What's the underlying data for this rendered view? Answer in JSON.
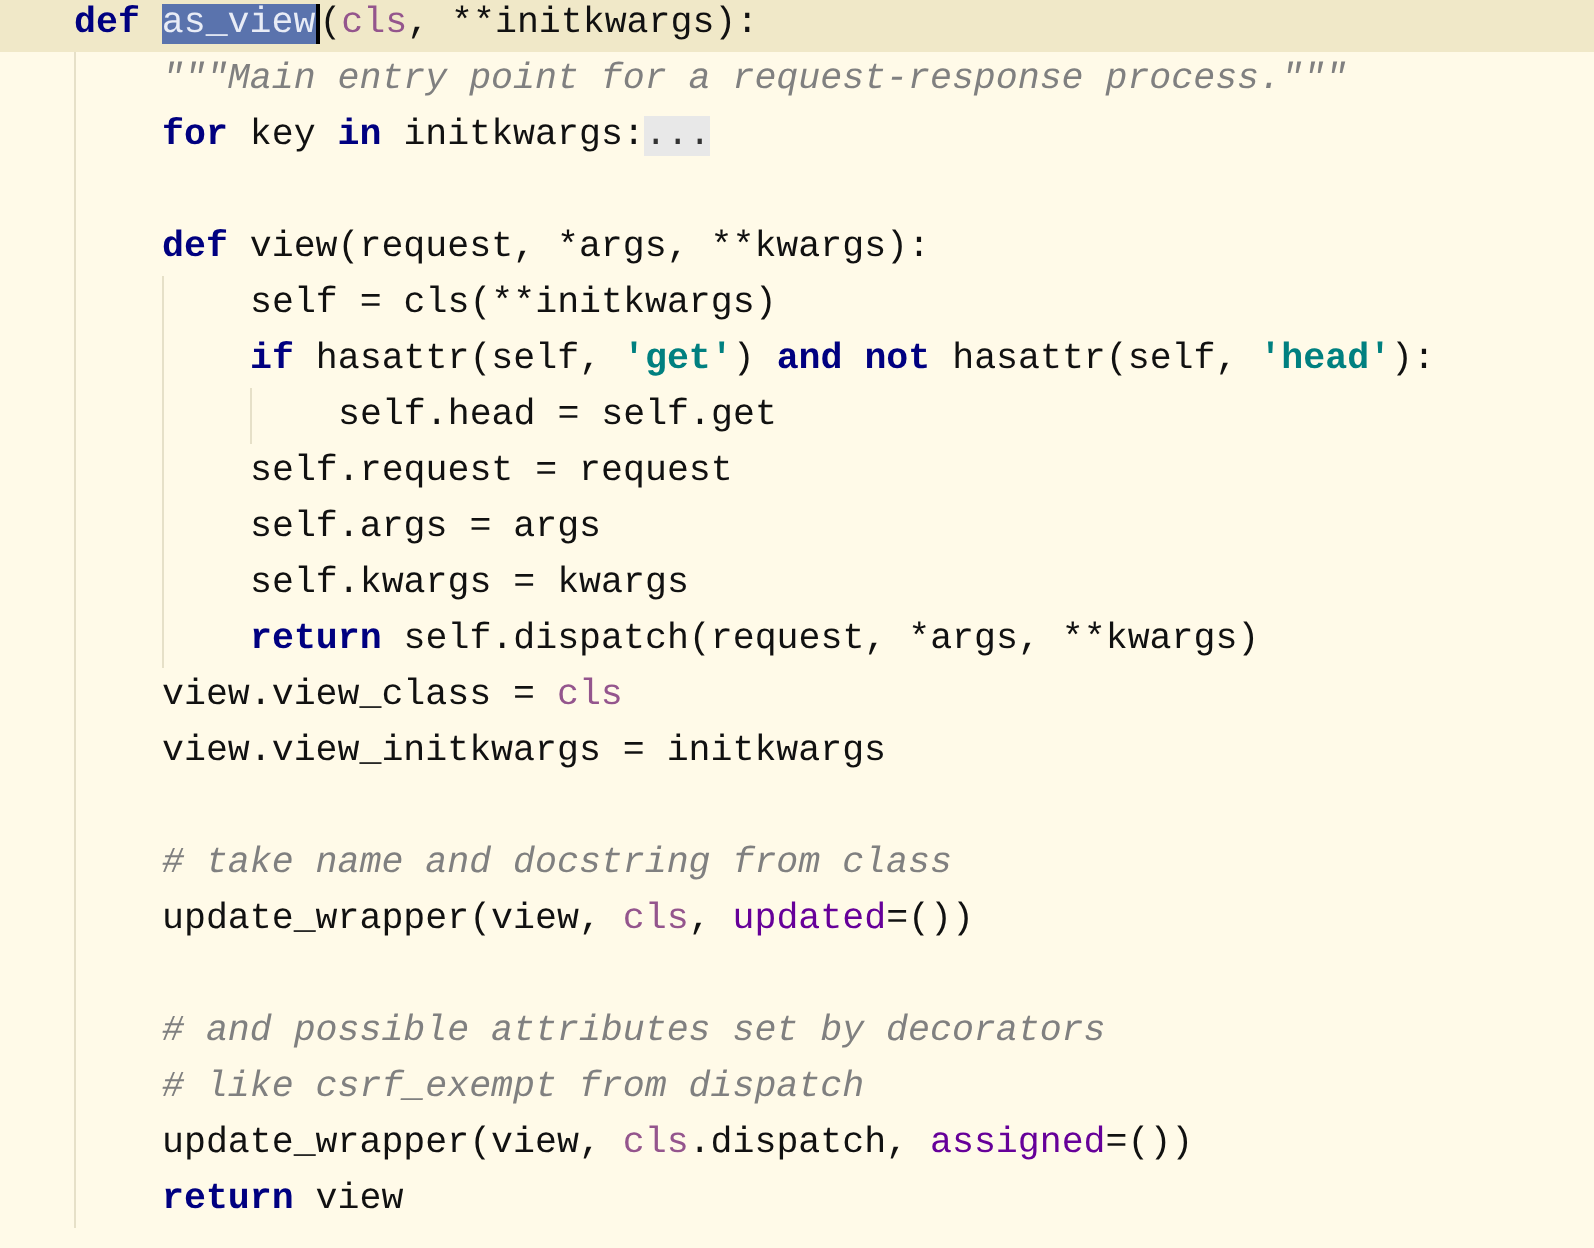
{
  "editor": {
    "lines": [
      {
        "kind": "code",
        "current": true,
        "tokens": [
          {
            "kind": "kw",
            "text": "def "
          },
          {
            "kind": "plain",
            "text": "as_view",
            "selected": true
          },
          {
            "kind": "plain",
            "text": "("
          },
          {
            "kind": "param",
            "text": "cls"
          },
          {
            "kind": "plain",
            "text": ", **initkwargs):"
          }
        ],
        "children": [
          {
            "kind": "code",
            "tokens": [
              {
                "kind": "doc",
                "text": "\"\"\"Main entry point for a request-response process.\"\"\""
              }
            ]
          },
          {
            "kind": "code",
            "tokens": [
              {
                "kind": "kw",
                "text": "for"
              },
              {
                "kind": "plain",
                "text": " key "
              },
              {
                "kind": "kw",
                "text": "in"
              },
              {
                "kind": "plain",
                "text": " initkwargs:"
              },
              {
                "kind": "fold",
                "text": "..."
              }
            ]
          },
          {
            "kind": "blank"
          },
          {
            "kind": "code",
            "tokens": [
              {
                "kind": "kw",
                "text": "def "
              },
              {
                "kind": "plain",
                "text": "view(request, *args, **kwargs):"
              }
            ],
            "children": [
              {
                "kind": "code",
                "tokens": [
                  {
                    "kind": "plain",
                    "text": "self = cls(**initkwargs)"
                  }
                ]
              },
              {
                "kind": "code",
                "tokens": [
                  {
                    "kind": "kw",
                    "text": "if "
                  },
                  {
                    "kind": "plain",
                    "text": "hasattr(self, "
                  },
                  {
                    "kind": "str",
                    "text": "'get'"
                  },
                  {
                    "kind": "plain",
                    "text": ") "
                  },
                  {
                    "kind": "kw",
                    "text": "and not "
                  },
                  {
                    "kind": "plain",
                    "text": "hasattr(self, "
                  },
                  {
                    "kind": "str",
                    "text": "'head'"
                  },
                  {
                    "kind": "plain",
                    "text": "):"
                  }
                ],
                "children": [
                  {
                    "kind": "code",
                    "tokens": [
                      {
                        "kind": "plain",
                        "text": "self.head = self.get"
                      }
                    ]
                  }
                ]
              },
              {
                "kind": "code",
                "tokens": [
                  {
                    "kind": "plain",
                    "text": "self.request = request"
                  }
                ]
              },
              {
                "kind": "code",
                "tokens": [
                  {
                    "kind": "plain",
                    "text": "self.args = args"
                  }
                ]
              },
              {
                "kind": "code",
                "tokens": [
                  {
                    "kind": "plain",
                    "text": "self.kwargs = kwargs"
                  }
                ]
              },
              {
                "kind": "code",
                "tokens": [
                  {
                    "kind": "kw",
                    "text": "return "
                  },
                  {
                    "kind": "plain",
                    "text": "self.dispatch(request, *args, **kwargs)"
                  }
                ]
              }
            ]
          },
          {
            "kind": "code",
            "tokens": [
              {
                "kind": "plain",
                "text": "view.view_class = "
              },
              {
                "kind": "param",
                "text": "cls"
              }
            ]
          },
          {
            "kind": "code",
            "tokens": [
              {
                "kind": "plain",
                "text": "view.view_initkwargs = initkwargs"
              }
            ]
          },
          {
            "kind": "blank"
          },
          {
            "kind": "code",
            "tokens": [
              {
                "kind": "comment",
                "text": "# take name and docstring from class"
              }
            ]
          },
          {
            "kind": "code",
            "tokens": [
              {
                "kind": "plain",
                "text": "update_wrapper(view, "
              },
              {
                "kind": "param",
                "text": "cls"
              },
              {
                "kind": "plain",
                "text": ", "
              },
              {
                "kind": "named",
                "text": "updated"
              },
              {
                "kind": "plain",
                "text": "=())"
              }
            ]
          },
          {
            "kind": "blank"
          },
          {
            "kind": "code",
            "tokens": [
              {
                "kind": "comment",
                "text": "# and possible attributes set by decorators"
              }
            ]
          },
          {
            "kind": "code",
            "tokens": [
              {
                "kind": "comment",
                "text": "# like csrf_exempt from dispatch"
              }
            ]
          },
          {
            "kind": "code",
            "tokens": [
              {
                "kind": "plain",
                "text": "update_wrapper(view, "
              },
              {
                "kind": "param",
                "text": "cls"
              },
              {
                "kind": "plain",
                "text": ".dispatch, "
              },
              {
                "kind": "named",
                "text": "assigned"
              },
              {
                "kind": "plain",
                "text": "=())"
              }
            ]
          },
          {
            "kind": "code",
            "tokens": [
              {
                "kind": "kw",
                "text": "return"
              },
              {
                "kind": "plain",
                "text": " view"
              }
            ]
          }
        ]
      }
    ]
  }
}
